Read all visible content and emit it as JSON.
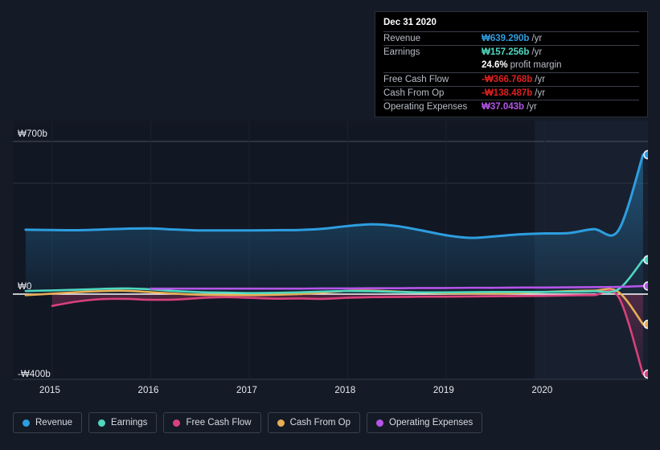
{
  "chart_data": {
    "type": "line",
    "title": "",
    "xlabel": "",
    "ylabel": "",
    "currency_symbol": "₩",
    "unit": "b",
    "period_suffix": "/yr",
    "grid": true,
    "legend_position": "bottom",
    "ylim": [
      -400,
      700
    ],
    "y_ticks": [
      {
        "label": "₩700b",
        "value": 700
      },
      {
        "label": "₩0",
        "value": 0
      },
      {
        "label": "-₩400b",
        "value": -400
      }
    ],
    "x_ticks": [
      {
        "label": "2015",
        "value": 2015
      },
      {
        "label": "2016",
        "value": 2016
      },
      {
        "label": "2017",
        "value": 2017
      },
      {
        "label": "2018",
        "value": 2018
      },
      {
        "label": "2019",
        "value": 2019
      },
      {
        "label": "2020",
        "value": 2020
      }
    ],
    "xlim": [
      2014.6,
      2021.05
    ],
    "forecast_band_start": 2019.9,
    "series": [
      {
        "name": "Revenue",
        "color": "#2d9ee0",
        "fill": true,
        "x": [
          2014.73,
          2015.0,
          2015.25,
          2015.5,
          2015.75,
          2016.0,
          2016.25,
          2016.5,
          2016.75,
          2017.0,
          2017.25,
          2017.5,
          2017.75,
          2018.0,
          2018.25,
          2018.5,
          2018.75,
          2019.0,
          2019.25,
          2019.5,
          2019.75,
          2020.0,
          2020.25,
          2020.5,
          2020.75,
          2021.0
        ],
        "values": [
          295,
          294,
          293,
          296,
          300,
          301,
          296,
          292,
          292,
          292,
          293,
          294,
          300,
          312,
          320,
          312,
          292,
          270,
          258,
          265,
          274,
          278,
          280,
          298,
          292,
          639
        ]
      },
      {
        "name": "Earnings",
        "color": "#4fd8c0",
        "fill": false,
        "x": [
          2014.73,
          2015.0,
          2015.25,
          2015.5,
          2015.75,
          2016.0,
          2016.25,
          2016.5,
          2016.75,
          2017.0,
          2017.25,
          2017.5,
          2017.75,
          2018.0,
          2018.25,
          2018.5,
          2018.75,
          2019.0,
          2019.25,
          2019.5,
          2019.75,
          2020.0,
          2020.25,
          2020.5,
          2020.75,
          2021.0
        ],
        "values": [
          14,
          17,
          20,
          24,
          26,
          22,
          14,
          9,
          7,
          5,
          6,
          8,
          12,
          14,
          13,
          10,
          8,
          8,
          9,
          10,
          10,
          10,
          11,
          13,
          22,
          157
        ]
      },
      {
        "name": "Free Cash Flow",
        "color": "#d9417c",
        "fill": false,
        "x": [
          2015.0,
          2015.25,
          2015.5,
          2015.75,
          2016.0,
          2016.25,
          2016.5,
          2016.75,
          2017.0,
          2017.25,
          2017.5,
          2017.75,
          2018.0,
          2018.25,
          2018.5,
          2018.75,
          2019.0,
          2019.25,
          2019.5,
          2019.75,
          2020.0,
          2020.25,
          2020.5,
          2020.75,
          2021.0
        ],
        "values": [
          -54,
          -34,
          -23,
          -22,
          -26,
          -25,
          -18,
          -14,
          -17,
          -21,
          -20,
          -22,
          -17,
          -14,
          -13,
          -12,
          -12,
          -11,
          -10,
          -9,
          -8,
          -6,
          -5,
          -12,
          -367
        ]
      },
      {
        "name": "Cash From Op",
        "color": "#e8ae55",
        "fill": false,
        "x": [
          2014.73,
          2015.0,
          2015.25,
          2015.5,
          2015.75,
          2016.0,
          2016.25,
          2016.5,
          2016.75,
          2017.0,
          2017.25,
          2017.5,
          2017.75,
          2018.0,
          2018.25,
          2018.5,
          2018.75,
          2019.0,
          2019.25,
          2019.5,
          2019.75,
          2020.0,
          2020.25,
          2020.5,
          2020.75,
          2021.0
        ],
        "values": [
          -5,
          2,
          9,
          14,
          15,
          9,
          2,
          -3,
          -4,
          -5,
          -3,
          0,
          7,
          15,
          16,
          12,
          7,
          4,
          3,
          3,
          5,
          10,
          14,
          16,
          10,
          -138
        ]
      },
      {
        "name": "Operating Expenses",
        "color": "#b455e8",
        "fill": false,
        "x": [
          2016.0,
          2016.25,
          2016.5,
          2016.75,
          2017.0,
          2017.25,
          2017.5,
          2017.75,
          2018.0,
          2018.25,
          2018.5,
          2018.75,
          2019.0,
          2019.25,
          2019.5,
          2019.75,
          2020.0,
          2020.25,
          2020.5,
          2020.75,
          2021.0
        ],
        "values": [
          25,
          25,
          25,
          25,
          25,
          25,
          25,
          26,
          26,
          27,
          27,
          28,
          28,
          29,
          29,
          30,
          30,
          31,
          32,
          33,
          37
        ]
      }
    ],
    "endpoint_markers": [
      {
        "series": "Revenue",
        "value": 639.29
      },
      {
        "series": "Earnings",
        "value": 157.256
      },
      {
        "series": "Operating Expenses",
        "value": 37.043
      },
      {
        "series": "Cash From Op",
        "value": -138.487
      },
      {
        "series": "Free Cash Flow",
        "value": -366.768
      }
    ]
  },
  "tooltip": {
    "date": "Dec 31 2020",
    "rows": [
      {
        "label": "Revenue",
        "value": "₩639.290b",
        "suffix": "/yr",
        "color": "#2d9ee0"
      },
      {
        "label": "Earnings",
        "value": "₩157.256b",
        "suffix": "/yr",
        "color": "#4fd8c0"
      },
      {
        "label": "",
        "value": "24.6%",
        "suffix": "profit margin",
        "color": "#ffffff",
        "sub": true
      },
      {
        "label": "Free Cash Flow",
        "value": "-₩366.768b",
        "suffix": "/yr",
        "color": "#e02020"
      },
      {
        "label": "Cash From Op",
        "value": "-₩138.487b",
        "suffix": "/yr",
        "color": "#e02020"
      },
      {
        "label": "Operating Expenses",
        "value": "₩37.043b",
        "suffix": "/yr",
        "color": "#b455e8"
      }
    ]
  },
  "legend": {
    "items": [
      {
        "label": "Revenue",
        "color": "#2d9ee0"
      },
      {
        "label": "Earnings",
        "color": "#4fd8c0"
      },
      {
        "label": "Free Cash Flow",
        "color": "#d9417c"
      },
      {
        "label": "Cash From Op",
        "color": "#e8ae55"
      },
      {
        "label": "Operating Expenses",
        "color": "#b455e8"
      }
    ]
  }
}
